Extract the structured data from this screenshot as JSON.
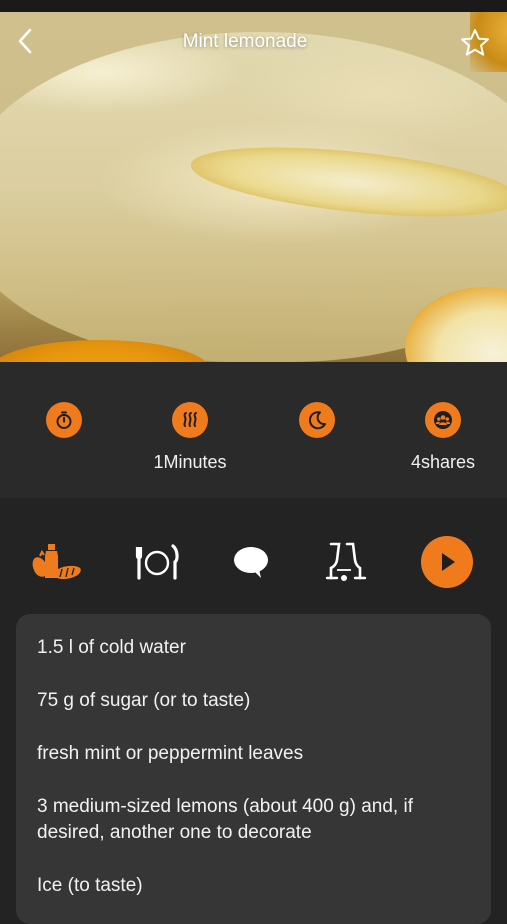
{
  "header": {
    "title": "Mint lemonade",
    "back_icon": "chevron-left-icon",
    "favorite_icon": "star-outline-icon"
  },
  "info": [
    {
      "icon": "timer-icon",
      "label": ""
    },
    {
      "icon": "heat-icon",
      "label": "1Minutes"
    },
    {
      "icon": "moon-icon",
      "label": ""
    },
    {
      "icon": "group-icon",
      "label": "4shares"
    }
  ],
  "tabs": [
    {
      "icon": "ingredients-icon",
      "active": true
    },
    {
      "icon": "cutlery-icon",
      "active": false
    },
    {
      "icon": "speech-bubble-icon",
      "active": false
    },
    {
      "icon": "drinks-icon",
      "active": false
    },
    {
      "icon": "play-icon",
      "active": false
    }
  ],
  "ingredients": [
    "1.5 l of cold water",
    "75 g of sugar (or to taste)",
    "fresh mint or peppermint leaves",
    "3 medium-sized lemons (about 400 g) and, if desired, another one to decorate",
    "Ice (to taste)"
  ],
  "colors": {
    "accent": "#f07b1d",
    "background": "#232323",
    "info_bg": "#2a2a2a",
    "card_bg": "#363636"
  }
}
